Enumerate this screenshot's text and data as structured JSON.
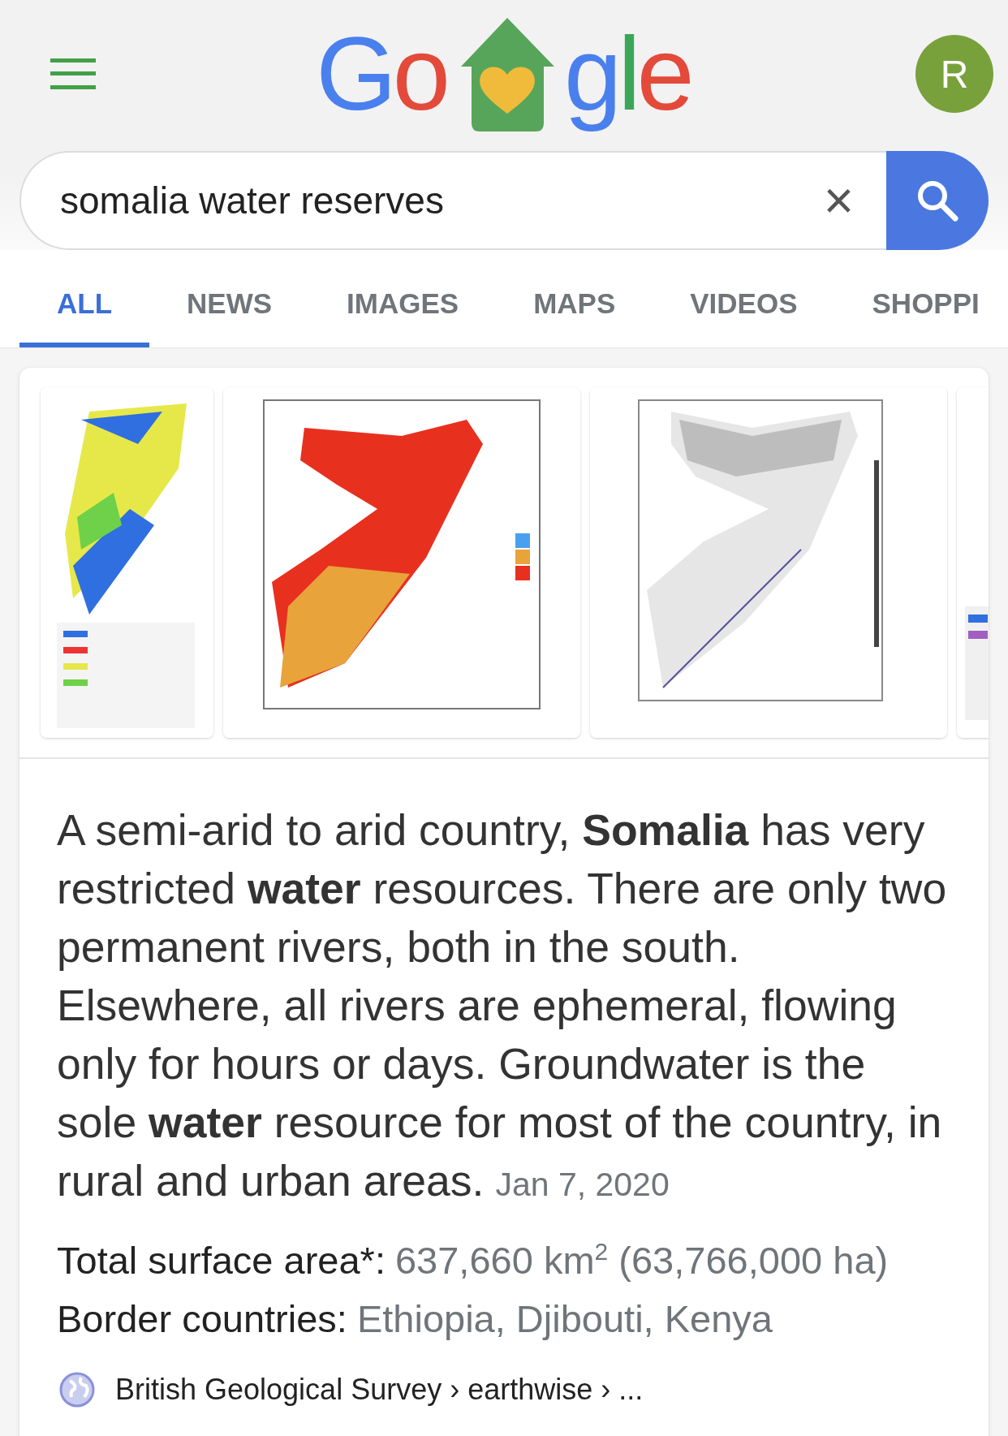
{
  "logo": {
    "before": "Go",
    "after": "gle"
  },
  "avatar": {
    "letter": "R"
  },
  "search": {
    "value": "somalia water reserves",
    "clear": "×"
  },
  "tabs": [
    {
      "label": "ALL",
      "selected": true
    },
    {
      "label": "NEWS",
      "selected": false
    },
    {
      "label": "IMAGES",
      "selected": false
    },
    {
      "label": "MAPS",
      "selected": false
    },
    {
      "label": "VIDEOS",
      "selected": false
    },
    {
      "label": "SHOPPI",
      "selected": false
    }
  ],
  "snippet": {
    "text": "A semi-arid to arid country, **Somalia** has very restricted **water** resources. There are only two permanent rivers, both in the south. Elsewhere, all rivers are ephemeral, flowing only for hours or days. Groundwater is the sole **water** resource for most of the country, in rural and urban areas.",
    "date": "Jan 7, 2020"
  },
  "facts": [
    {
      "label": "Total surface area*:",
      "value": "637,660 km$^{2}$ (63,766,000 ha)"
    },
    {
      "label": "Border countries:",
      "value": "Ethiopia, Djibouti, Kenya"
    }
  ],
  "source": {
    "text": "British Geological Survey › earthwise › ..."
  }
}
